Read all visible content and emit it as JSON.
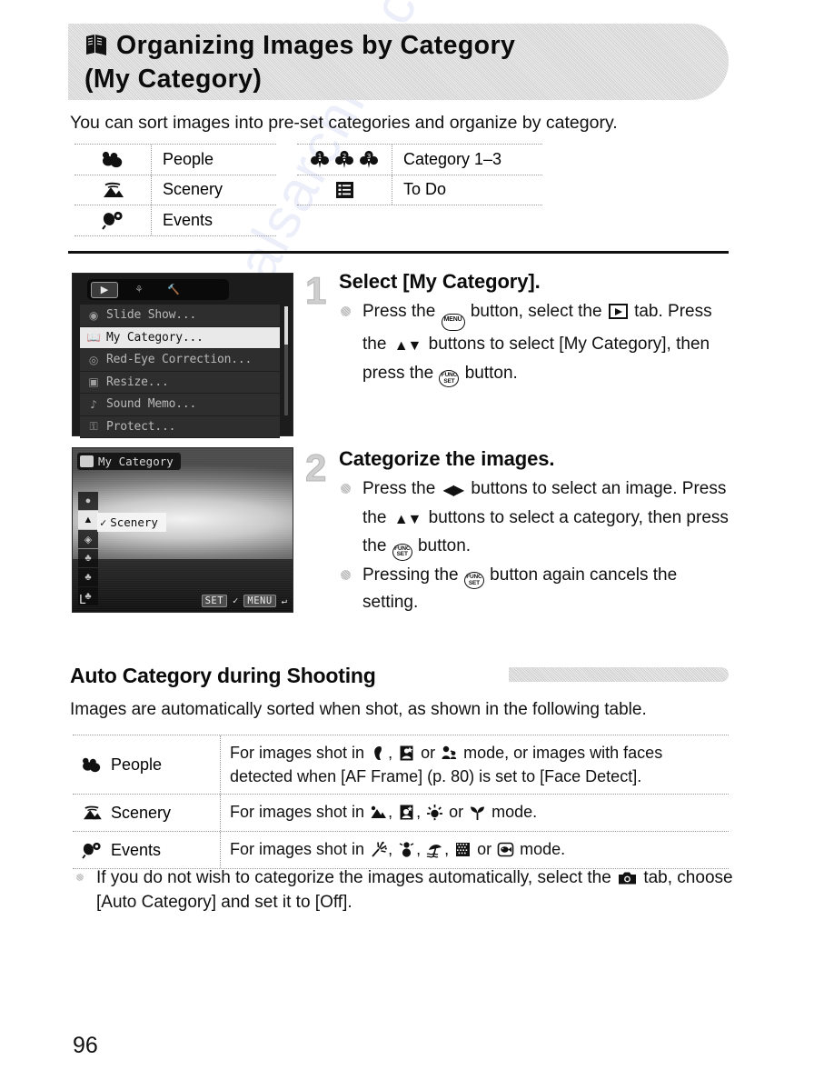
{
  "header": {
    "icon": "book-album-icon",
    "line1": "Organizing Images by Category",
    "line2": "(My Category)"
  },
  "intro": "You can sort images into pre-set categories and organize by category.",
  "legend": {
    "left": [
      {
        "icon": "people-icon",
        "label": "People"
      },
      {
        "icon": "scenery-icon",
        "label": "Scenery"
      },
      {
        "icon": "events-icon",
        "label": "Events"
      }
    ],
    "right": [
      {
        "icon": "club-1-2-3-icon",
        "label": "Category 1–3"
      },
      {
        "icon": "todo-checklist-icon",
        "label": "To Do"
      }
    ]
  },
  "steps": [
    {
      "number": "1",
      "heading": "Select [My Category].",
      "bullets": [
        {
          "parts": [
            {
              "t": "text",
              "v": "Press the "
            },
            {
              "t": "glyph",
              "v": "MENU"
            },
            {
              "t": "text",
              "v": " button, select the "
            },
            {
              "t": "glyph",
              "v": "PLAY"
            },
            {
              "t": "text",
              "v": " tab. Press the "
            },
            {
              "t": "glyph",
              "v": "UPDOWN"
            },
            {
              "t": "text",
              "v": " buttons to select [My Category], then press the "
            },
            {
              "t": "glyph",
              "v": "FUNCSET"
            },
            {
              "t": "text",
              "v": " button."
            }
          ]
        }
      ]
    },
    {
      "number": "2",
      "heading": "Categorize the images.",
      "bullets": [
        {
          "parts": [
            {
              "t": "text",
              "v": "Press the "
            },
            {
              "t": "glyph",
              "v": "LEFTRIGHT"
            },
            {
              "t": "text",
              "v": " buttons to select an image. Press the "
            },
            {
              "t": "glyph",
              "v": "UPDOWN"
            },
            {
              "t": "text",
              "v": " buttons to select a category, then press the "
            },
            {
              "t": "glyph",
              "v": "FUNCSET"
            },
            {
              "t": "text",
              "v": " button."
            }
          ]
        },
        {
          "parts": [
            {
              "t": "text",
              "v": "Pressing the "
            },
            {
              "t": "glyph",
              "v": "FUNCSET"
            },
            {
              "t": "text",
              "v": " button again cancels the setting."
            }
          ]
        }
      ]
    }
  ],
  "screenshot1": {
    "name": "playback-menu-screen",
    "tabs": [
      {
        "name": "playback-tab",
        "active": true
      },
      {
        "name": "print-tab",
        "active": false
      },
      {
        "name": "settings-tab",
        "active": false
      }
    ],
    "items": [
      {
        "icon": "slideshow-icon",
        "label": "Slide Show...",
        "selected": false
      },
      {
        "icon": "my-category-icon",
        "label": "My Category...",
        "selected": true
      },
      {
        "icon": "red-eye-icon",
        "label": "Red-Eye Correction...",
        "selected": false
      },
      {
        "icon": "resize-icon",
        "label": "Resize...",
        "selected": false
      },
      {
        "icon": "sound-memo-icon",
        "label": "Sound Memo...",
        "selected": false
      },
      {
        "icon": "protect-icon",
        "label": "Protect...",
        "selected": false
      }
    ]
  },
  "screenshot2": {
    "name": "my-category-select-screen",
    "title": "My Category",
    "selected_category": "Scenery",
    "check_mark": "✓",
    "bottom_controls": [
      {
        "name": "set-key",
        "label": "SET"
      },
      {
        "name": "check-mark",
        "label": "✓"
      },
      {
        "name": "menu-key",
        "label": "MENU"
      },
      {
        "name": "back-arrow",
        "label": "↵"
      }
    ],
    "quality_indicator": "L"
  },
  "auto_section": {
    "title": "Auto Category during Shooting",
    "intro": "Images are automatically sorted when shot, as shown in the following table.",
    "rows": [
      {
        "icon": "people-icon",
        "name": "People",
        "desc_parts": [
          {
            "t": "text",
            "v": "For images shot in "
          },
          {
            "t": "mode",
            "v": "portrait-mode-icon"
          },
          {
            "t": "text",
            "v": ", "
          },
          {
            "t": "mode",
            "v": "night-snapshot-mode-icon"
          },
          {
            "t": "text",
            "v": " or "
          },
          {
            "t": "mode",
            "v": "kids-and-pets-mode-icon"
          },
          {
            "t": "text",
            "v": " mode, or images with faces detected when [AF Frame] (p. 80) is set to [Face Detect]."
          }
        ]
      },
      {
        "icon": "scenery-icon",
        "name": "Scenery",
        "desc_parts": [
          {
            "t": "text",
            "v": "For images shot in "
          },
          {
            "t": "mode",
            "v": "landscape-mode-icon"
          },
          {
            "t": "text",
            "v": ", "
          },
          {
            "t": "mode",
            "v": "night-scene-mode-icon"
          },
          {
            "t": "text",
            "v": ", "
          },
          {
            "t": "mode",
            "v": "sunset-mode-icon"
          },
          {
            "t": "text",
            "v": " or "
          },
          {
            "t": "mode",
            "v": "foliage-mode-icon"
          },
          {
            "t": "text",
            "v": " mode."
          }
        ]
      },
      {
        "icon": "events-icon",
        "name": "Events",
        "desc_parts": [
          {
            "t": "text",
            "v": "For images shot in "
          },
          {
            "t": "mode",
            "v": "fireworks-mode-icon"
          },
          {
            "t": "text",
            "v": ", "
          },
          {
            "t": "mode",
            "v": "snow-mode-icon"
          },
          {
            "t": "text",
            "v": ", "
          },
          {
            "t": "mode",
            "v": "beach-mode-icon"
          },
          {
            "t": "text",
            "v": ", "
          },
          {
            "t": "mode",
            "v": "indoor-mode-icon"
          },
          {
            "t": "text",
            "v": " or "
          },
          {
            "t": "mode",
            "v": "aquarium-mode-icon"
          },
          {
            "t": "text",
            "v": " mode."
          }
        ]
      }
    ]
  },
  "footnote": {
    "part1": "If you do not wish to categorize the images automatically, select the ",
    "icon": "camera-tab-icon",
    "part2": " tab, choose [Auto Category] and set it to [Off]."
  },
  "page_number": "96",
  "watermark": "manualsarchive.com"
}
